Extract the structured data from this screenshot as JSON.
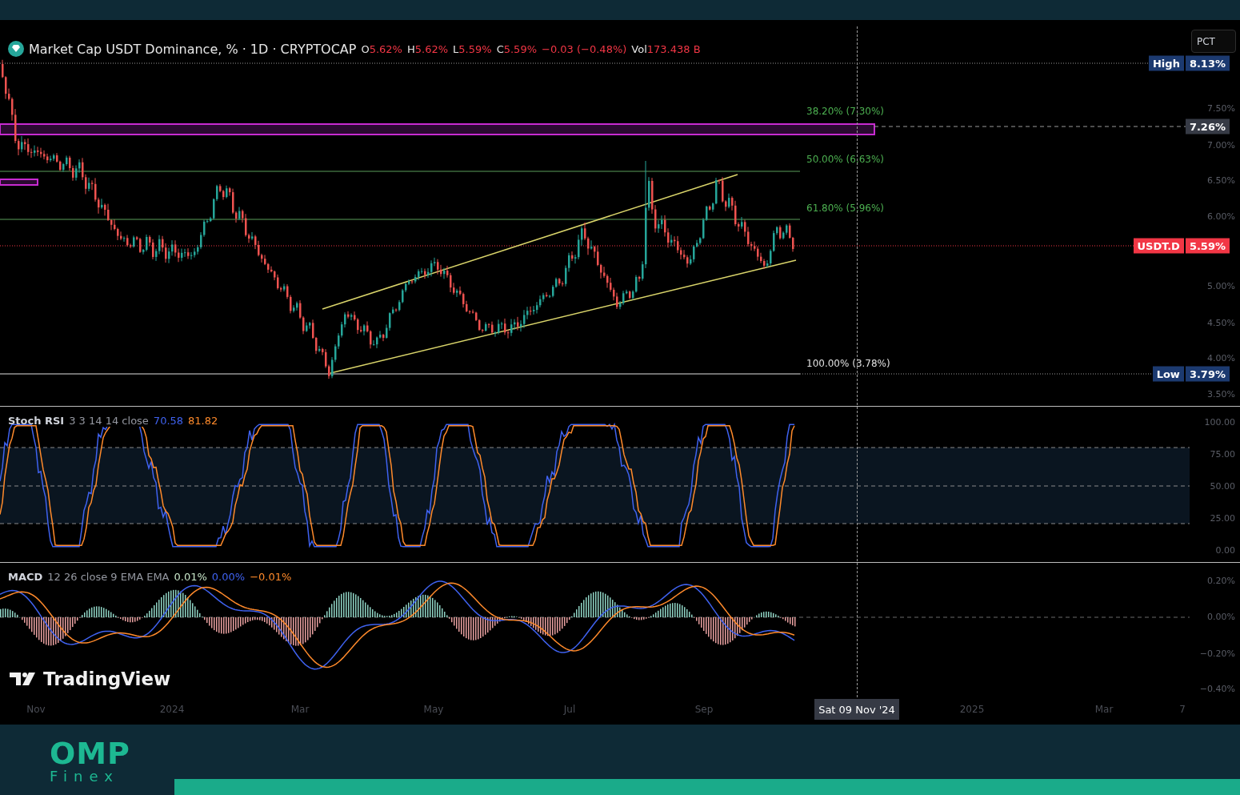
{
  "header": {
    "symbol": "Market Cap USDT Dominance, % · 1D · CRYPTOCAP",
    "ohlc": [
      {
        "label": "O",
        "value": "5.62%"
      },
      {
        "label": "H",
        "value": "5.62%"
      },
      {
        "label": "L",
        "value": "5.59%"
      },
      {
        "label": "C",
        "value": "5.59%"
      }
    ],
    "change": "−0.03 (−0.48%)",
    "volume": {
      "label": "Vol",
      "value": "173.438 B"
    }
  },
  "scale_button": "PCT",
  "price_axis": {
    "ticks": [
      "7.50%",
      "7.00%",
      "6.50%",
      "6.00%",
      "5.00%",
      "4.50%",
      "4.00%",
      "3.50%"
    ],
    "badges": [
      {
        "kind": "high",
        "label": "High",
        "value": "8.13%"
      },
      {
        "kind": "crosshair",
        "value": "7.26%"
      },
      {
        "kind": "last",
        "label": "USDT.D",
        "value": "5.59%"
      },
      {
        "kind": "low",
        "label": "Low",
        "value": "3.79%"
      }
    ]
  },
  "fib_levels": [
    {
      "label": "38.20% (7.30%)",
      "color": "#4caf50"
    },
    {
      "label": "50.00% (6.63%)",
      "color": "#4caf50"
    },
    {
      "label": "61.80% (5.96%)",
      "color": "#4caf50"
    },
    {
      "label": "100.00% (3.78%)",
      "color": "#e0e0e0"
    }
  ],
  "stoch_rsi": {
    "name": "Stoch RSI",
    "params": "3 3 14 14 close",
    "values": [
      {
        "text": "70.58",
        "color": "#3f62f0"
      },
      {
        "text": "81.82",
        "color": "#ff8a2b"
      }
    ],
    "ticks": [
      "100.00",
      "75.00",
      "50.00",
      "25.00",
      "0.00"
    ]
  },
  "macd": {
    "name": "MACD",
    "params": "12 26 close 9 EMA EMA",
    "values": [
      {
        "text": "0.01%",
        "color": "#c8e6c9"
      },
      {
        "text": "0.00%",
        "color": "#3f62f0"
      },
      {
        "text": "−0.01%",
        "color": "#ff8a2b"
      }
    ],
    "ticks": [
      "0.20%",
      "0.00%",
      "−0.20%",
      "−0.40%"
    ]
  },
  "logo": "TradingView",
  "time_axis": {
    "labels": [
      "Nov",
      "2024",
      "Mar",
      "May",
      "Jul",
      "Sep",
      "2025",
      "Mar",
      "7"
    ],
    "crosshair_label": "Sat 09 Nov '24"
  },
  "brand": {
    "name": "OMP",
    "tagline": "Finex"
  }
}
